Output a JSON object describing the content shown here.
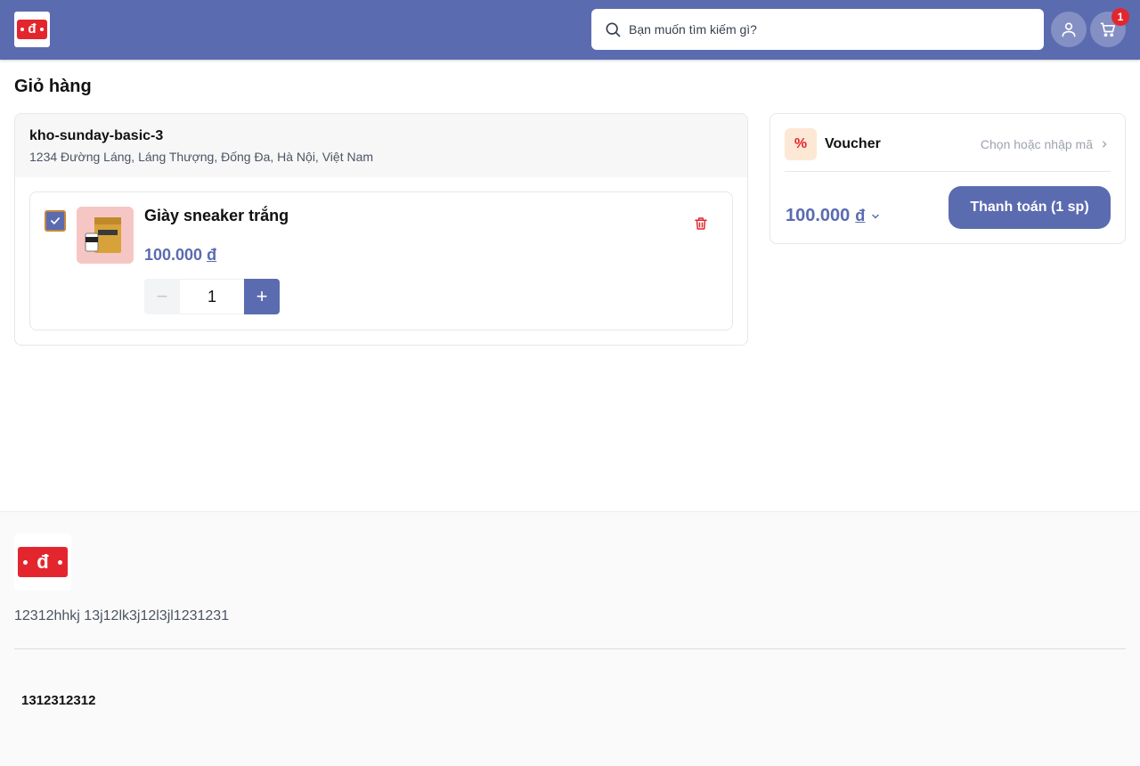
{
  "header": {
    "logo": "logo-icon",
    "search_placeholder": "Bạn muốn tìm kiếm gì?",
    "cart_count": "1",
    "brand_color": "#5b6bb0"
  },
  "page": {
    "title": "Giỏ hàng"
  },
  "cart": {
    "store_name": "kho-sunday-basic-3",
    "store_address": "1234 Đường Láng, Láng Thượng, Đống Đa, Hà Nội, Việt Nam",
    "items": [
      {
        "name": "Giày sneaker trắng",
        "price": "100.000",
        "currency": "đ",
        "quantity": "1",
        "checked": true
      }
    ]
  },
  "summary": {
    "voucher_title": "Voucher",
    "voucher_pick": "Chọn hoặc nhập mã",
    "total": "100.000",
    "currency": "đ",
    "pay_label": "Thanh toán (1 sp)"
  },
  "footer": {
    "description": "12312hhkj 13j12lk3j12l3jl1231231",
    "bottom_text": "1312312312"
  }
}
